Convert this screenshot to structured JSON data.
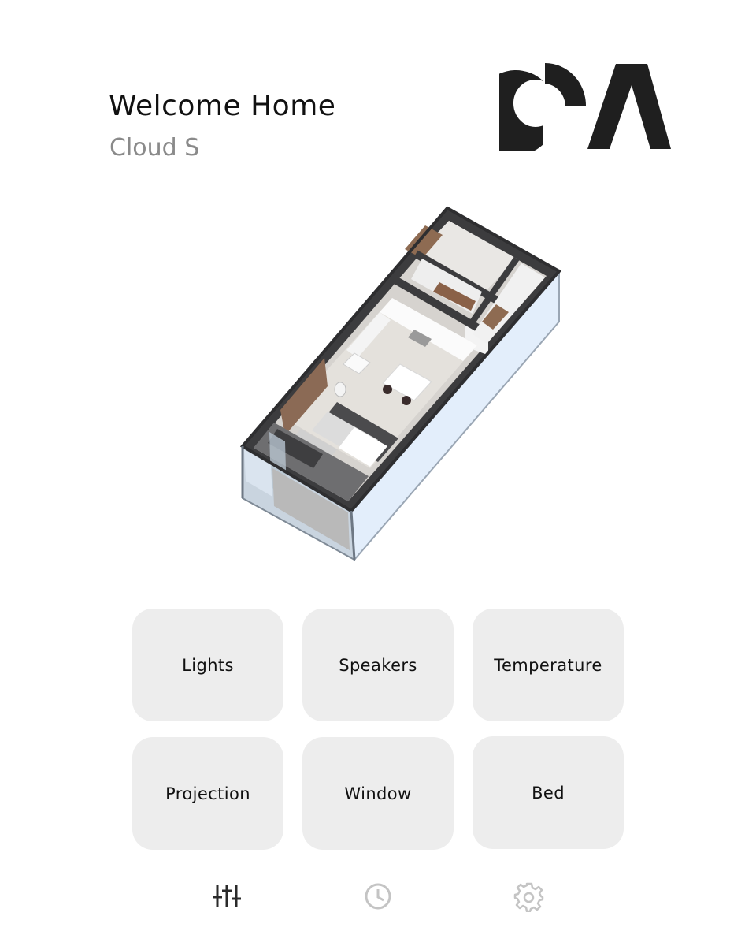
{
  "header": {
    "title": "Welcome Home",
    "subtitle": "Cloud S"
  },
  "logo": {
    "icon": "brand-logo-icon",
    "color": "#1f1f1f"
  },
  "floorplan": {
    "icon": "isometric-apartment-floorplan"
  },
  "tiles": [
    {
      "label": "Lights"
    },
    {
      "label": "Speakers"
    },
    {
      "label": "Temperature"
    },
    {
      "label": "Projection"
    },
    {
      "label": "Window"
    },
    {
      "label": "Bed"
    }
  ],
  "nav": {
    "items": [
      {
        "icon": "sliders-icon",
        "active": true
      },
      {
        "icon": "clock-icon",
        "active": false
      },
      {
        "icon": "gear-icon",
        "active": false
      }
    ]
  },
  "colors": {
    "tile_bg": "#ededed",
    "nav_active": "#2a2a2a",
    "nav_inactive": "#c4c4c4",
    "subtitle": "#8a8a8a"
  }
}
